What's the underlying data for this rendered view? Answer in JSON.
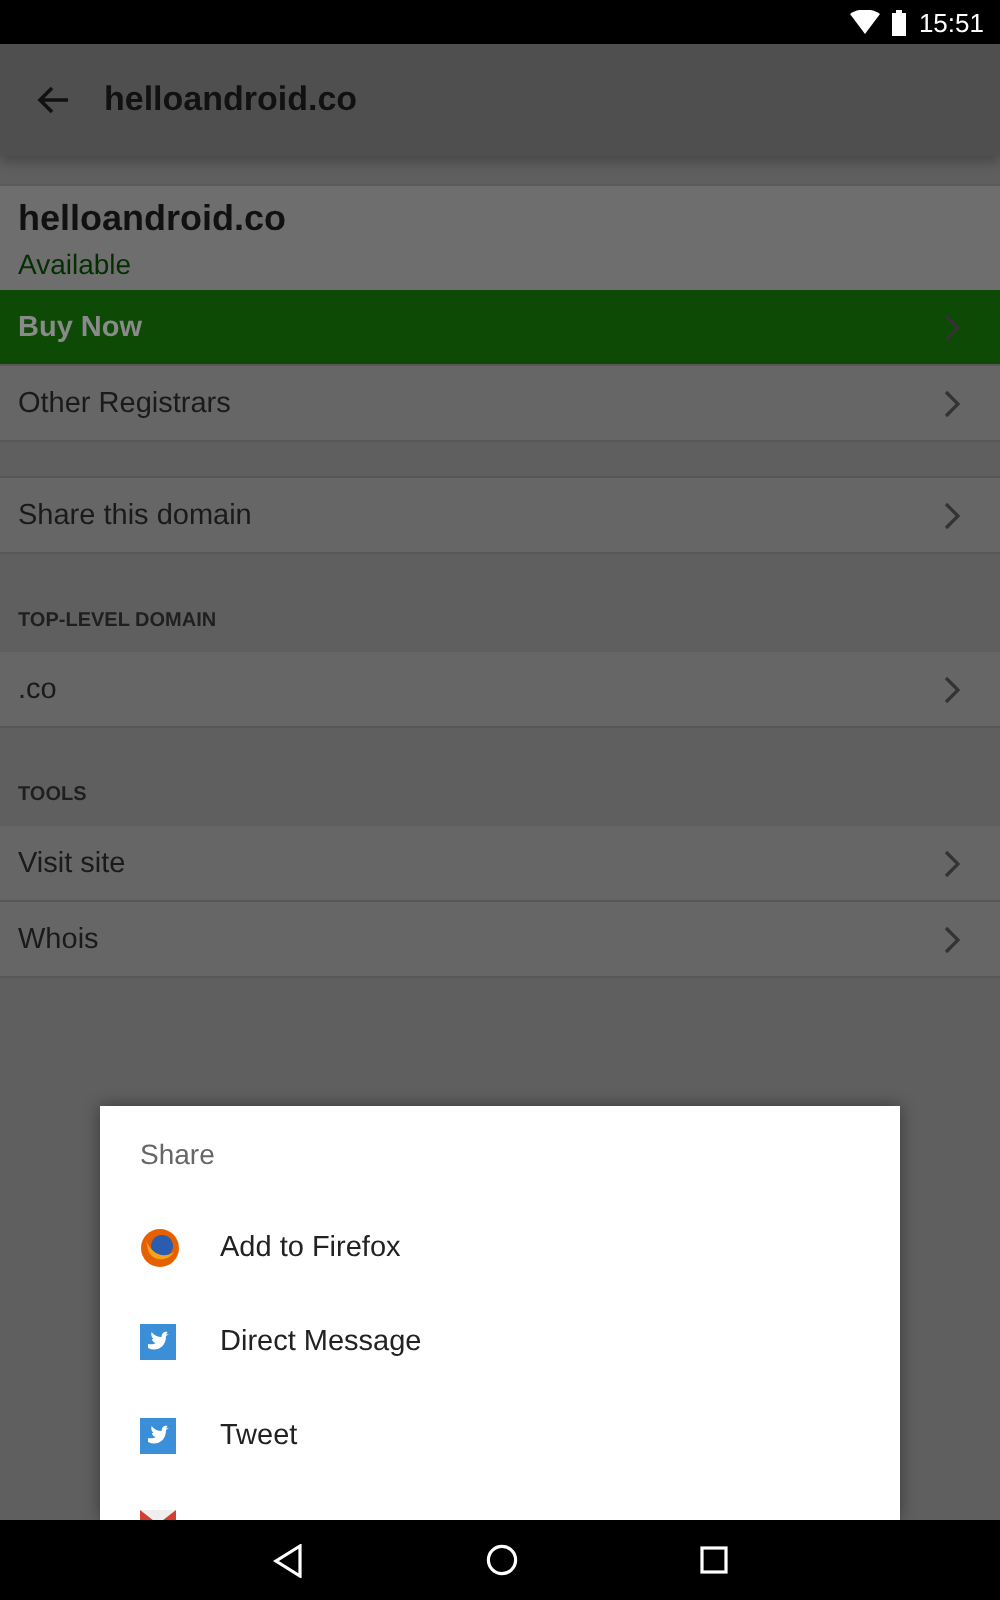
{
  "status_bar": {
    "time": "15:51"
  },
  "toolbar": {
    "title": "helloandroid.co"
  },
  "domain": {
    "name": "helloandroid.co",
    "status": "Available"
  },
  "sections": [
    {
      "rows": [
        {
          "label": "Buy Now",
          "primary": true
        },
        {
          "label": "Other Registrars",
          "primary": false
        }
      ]
    },
    {
      "rows": [
        {
          "label": "Share this domain",
          "primary": false
        }
      ]
    },
    {
      "header": "TOP-LEVEL DOMAIN",
      "rows": [
        {
          "label": ".co",
          "primary": false
        }
      ]
    },
    {
      "header": "TOOLS",
      "rows": [
        {
          "label": "Visit site",
          "primary": false
        },
        {
          "label": "Whois",
          "primary": false
        }
      ]
    }
  ],
  "share_dialog": {
    "title": "Share",
    "items": [
      {
        "kind": "firefox",
        "label": "Add to Firefox"
      },
      {
        "kind": "twitter",
        "label": "Direct Message"
      },
      {
        "kind": "twitter",
        "label": "Tweet"
      },
      {
        "kind": "mail"
      }
    ]
  }
}
